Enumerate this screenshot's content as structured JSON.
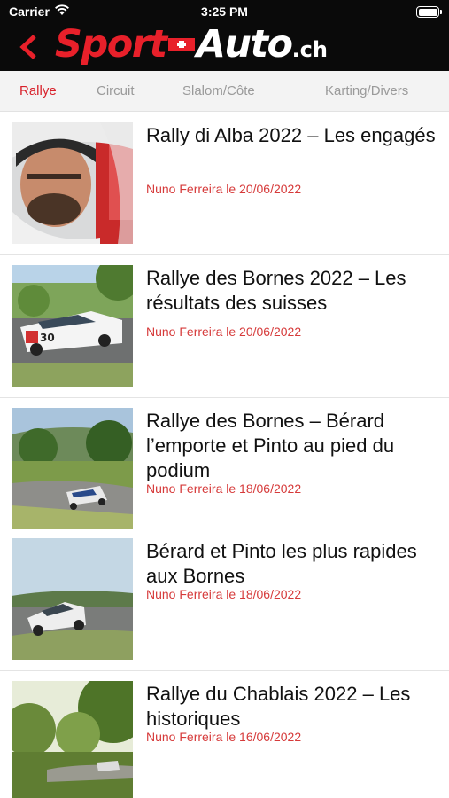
{
  "status_bar": {
    "carrier": "Carrier",
    "time": "3:25 PM"
  },
  "header": {
    "logo": {
      "part1": "Sport",
      "part2": "Auto",
      "suffix": ".ch"
    },
    "back_icon": "chevron-left-icon",
    "accent_color": "#e8202a"
  },
  "tabs": [
    {
      "label": "Rallye",
      "active": true
    },
    {
      "label": "Circuit",
      "active": false
    },
    {
      "label": "Slalom/Côte",
      "active": false
    },
    {
      "label": "Karting/Divers",
      "active": false
    }
  ],
  "articles": [
    {
      "title": "Rally di Alba 2022 – Les engagés",
      "meta": "Nuno Ferreira le 20/06/2022"
    },
    {
      "title": "Rallye des Bornes 2022 – Les résultats des suisses",
      "meta": "Nuno Ferreira le 20/06/2022"
    },
    {
      "title": "Rallye des Bornes – Bérard l’emporte et Pinto au pied du podium",
      "meta": "Nuno Ferreira le 18/06/2022"
    },
    {
      "title": "Bérard et Pinto les plus rapides aux Bornes",
      "meta": "Nuno Ferreira le 18/06/2022"
    },
    {
      "title": "Rallye du Chablais 2022 – Les historiques",
      "meta": "Nuno Ferreira le 16/06/2022"
    }
  ]
}
